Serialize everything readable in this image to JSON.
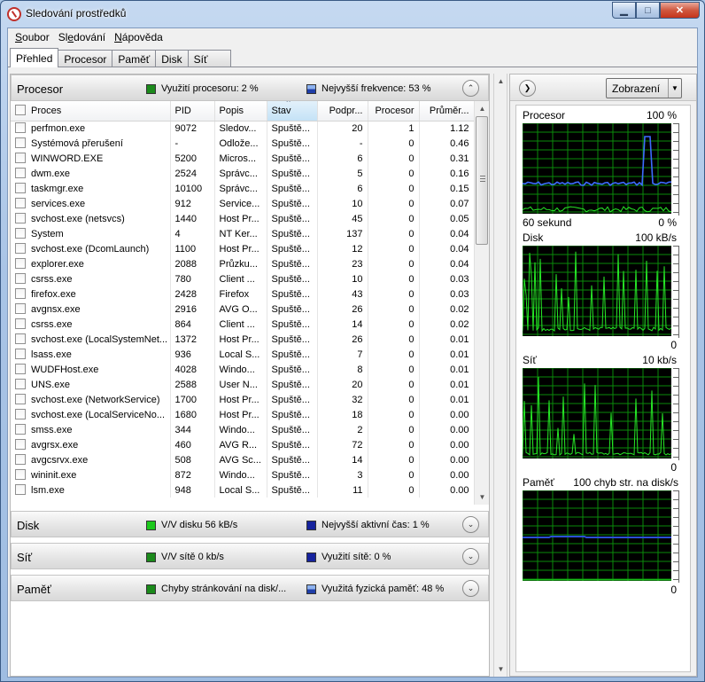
{
  "window": {
    "title": "Sledování prostředků"
  },
  "menu": [
    {
      "pre": "",
      "u": "S",
      "post": "oubor"
    },
    {
      "pre": "Sl",
      "u": "e",
      "post": "dování"
    },
    {
      "pre": "",
      "u": "N",
      "post": "ápověda"
    }
  ],
  "tabs": [
    "Přehled",
    "Procesor",
    "Paměť",
    "Disk",
    "Síť"
  ],
  "cpu_section": {
    "title": "Procesor",
    "stat1": "Využití procesoru: 2 %",
    "stat2": "Nejvyšší frekvence: 53 %",
    "columns": [
      "Proces",
      "PID",
      "Popis",
      "Stav",
      "Podpr...",
      "Procesor",
      "Průměr..."
    ],
    "rows": [
      [
        "perfmon.exe",
        "9072",
        "Sledov...",
        "Spuště...",
        "20",
        "1",
        "1.12"
      ],
      [
        "Systémová přerušení",
        "-",
        "Odlože...",
        "Spuště...",
        "-",
        "0",
        "0.46"
      ],
      [
        "WINWORD.EXE",
        "5200",
        "Micros...",
        "Spuště...",
        "6",
        "0",
        "0.31"
      ],
      [
        "dwm.exe",
        "2524",
        "Správc...",
        "Spuště...",
        "5",
        "0",
        "0.16"
      ],
      [
        "taskmgr.exe",
        "10100",
        "Správc...",
        "Spuště...",
        "6",
        "0",
        "0.15"
      ],
      [
        "services.exe",
        "912",
        "Service...",
        "Spuště...",
        "10",
        "0",
        "0.07"
      ],
      [
        "svchost.exe (netsvcs)",
        "1440",
        "Host Pr...",
        "Spuště...",
        "45",
        "0",
        "0.05"
      ],
      [
        "System",
        "4",
        "NT Ker...",
        "Spuště...",
        "137",
        "0",
        "0.04"
      ],
      [
        "svchost.exe (DcomLaunch)",
        "1100",
        "Host Pr...",
        "Spuště...",
        "12",
        "0",
        "0.04"
      ],
      [
        "explorer.exe",
        "2088",
        "Průzku...",
        "Spuště...",
        "23",
        "0",
        "0.04"
      ],
      [
        "csrss.exe",
        "780",
        "Client ...",
        "Spuště...",
        "10",
        "0",
        "0.03"
      ],
      [
        "firefox.exe",
        "2428",
        "Firefox",
        "Spuště...",
        "43",
        "0",
        "0.03"
      ],
      [
        "avgnsx.exe",
        "2916",
        "AVG O...",
        "Spuště...",
        "26",
        "0",
        "0.02"
      ],
      [
        "csrss.exe",
        "864",
        "Client ...",
        "Spuště...",
        "14",
        "0",
        "0.02"
      ],
      [
        "svchost.exe (LocalSystemNet...",
        "1372",
        "Host Pr...",
        "Spuště...",
        "26",
        "0",
        "0.01"
      ],
      [
        "lsass.exe",
        "936",
        "Local S...",
        "Spuště...",
        "7",
        "0",
        "0.01"
      ],
      [
        "WUDFHost.exe",
        "4028",
        "Windo...",
        "Spuště...",
        "8",
        "0",
        "0.01"
      ],
      [
        "UNS.exe",
        "2588",
        "User N...",
        "Spuště...",
        "20",
        "0",
        "0.01"
      ],
      [
        "svchost.exe (NetworkService)",
        "1700",
        "Host Pr...",
        "Spuště...",
        "32",
        "0",
        "0.01"
      ],
      [
        "svchost.exe (LocalServiceNo...",
        "1680",
        "Host Pr...",
        "Spuště...",
        "18",
        "0",
        "0.00"
      ],
      [
        "smss.exe",
        "344",
        "Windo...",
        "Spuště...",
        "2",
        "0",
        "0.00"
      ],
      [
        "avgrsx.exe",
        "460",
        "AVG R...",
        "Spuště...",
        "72",
        "0",
        "0.00"
      ],
      [
        "avgcsrvx.exe",
        "508",
        "AVG Sc...",
        "Spuště...",
        "14",
        "0",
        "0.00"
      ],
      [
        "wininit.exe",
        "872",
        "Windo...",
        "Spuště...",
        "3",
        "0",
        "0.00"
      ],
      [
        "lsm.exe",
        "948",
        "Local S...",
        "Spuště...",
        "11",
        "0",
        "0.00"
      ]
    ]
  },
  "disk_section": {
    "title": "Disk",
    "stat1": "V/V disku 56 kB/s",
    "stat2": "Nejvyšší aktivní čas: 1 %"
  },
  "net_section": {
    "title": "Síť",
    "stat1": "V/V sítě 0 kb/s",
    "stat2": "Využití sítě: 0 %"
  },
  "mem_section": {
    "title": "Paměť",
    "stat1": "Chyby stránkování na disk/...",
    "stat2": "Využitá fyzická paměť: 48 %"
  },
  "right_panel": {
    "view_button": "Zobrazení",
    "graphs": [
      {
        "title": "Procesor",
        "max": "100 %",
        "foot_left": "60 sekund",
        "foot_right": "0 %"
      },
      {
        "title": "Disk",
        "max": "100 kB/s",
        "foot_left": "",
        "foot_right": "0"
      },
      {
        "title": "Síť",
        "max": "10 kb/s",
        "foot_left": "",
        "foot_right": "0"
      },
      {
        "title": "Paměť",
        "max": "100 chyb str. na disk/s",
        "foot_left": "",
        "foot_right": "0"
      }
    ]
  },
  "icons": {
    "nav_right": "chevron-right-icon",
    "collapse": "chevron-up-icon",
    "expand": "chevron-down-icon"
  },
  "colors": {
    "graph_bg": "#000000",
    "grid": "#0a8a0a",
    "cpu_line": "#3d6bff",
    "green_line": "#27e827",
    "mem_line": "#2c4fd6"
  }
}
